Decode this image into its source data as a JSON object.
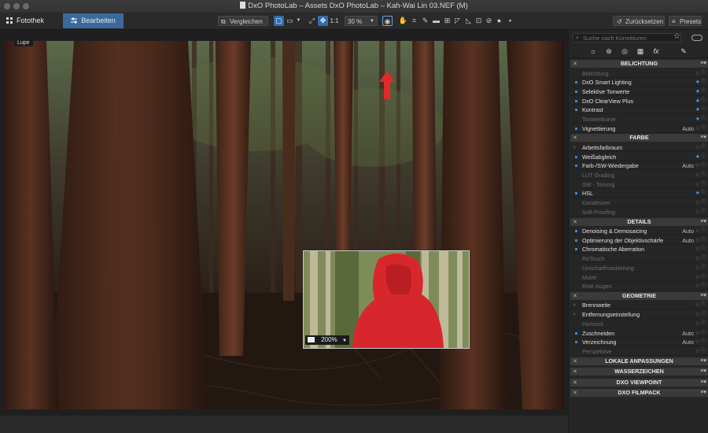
{
  "window": {
    "title": "DxO PhotoLab – Assets DxO PhotoLab – Kah-Wai Lin 03.NEF (M)"
  },
  "toolbar": {
    "tab_library": "Fotothek",
    "tab_edit": "Bearbeiten",
    "compare_label": "Vergleichen",
    "zoom_1to1": "1:1",
    "zoom_value": "30 %",
    "reset_label": "Zurücksetzen",
    "presets_label": "Presets"
  },
  "viewer": {
    "loupe_label": "Lupe",
    "loupe_zoom": "200%"
  },
  "colors": {
    "accent": "#2f6fb0",
    "arrow": "#e02a2a",
    "section_bg": "#3a3a3a",
    "favorite_star": "#4a94e6"
  },
  "panel": {
    "search_placeholder": "Suche nach Korrekturen",
    "sections": [
      {
        "title": "BELICHTUNG",
        "rows": [
          {
            "label": "Belichtung",
            "state": "off"
          },
          {
            "label": "DxO Smart Lighting",
            "state": "on",
            "fav": true
          },
          {
            "label": "Selektive Tonwerte",
            "state": "on",
            "fav": true
          },
          {
            "label": "DxO ClearView Plus",
            "state": "on",
            "fav": true
          },
          {
            "label": "Kontrast",
            "state": "on",
            "fav": true
          },
          {
            "label": "Tonwertkurve",
            "state": "off",
            "fav": true
          },
          {
            "label": "Vignettierung",
            "state": "on",
            "auto": "Auto"
          }
        ]
      },
      {
        "title": "FARBE",
        "rows": [
          {
            "label": "Arbeitsfarbraum",
            "state": "on",
            "chev": true
          },
          {
            "label": "Weißabgleich",
            "state": "on",
            "fav": true
          },
          {
            "label": "Farb-/SW-Wiedergabe",
            "state": "on",
            "auto": "Auto"
          },
          {
            "label": "LUT Grading",
            "state": "off"
          },
          {
            "label": "SW - Tonung",
            "state": "off"
          },
          {
            "label": "HSL",
            "state": "on",
            "fav": true
          },
          {
            "label": "Kanalmixer",
            "state": "off"
          },
          {
            "label": "Soft-Proofing",
            "state": "off"
          }
        ]
      },
      {
        "title": "DETAILS",
        "rows": [
          {
            "label": "Denoising & Demosaicing",
            "state": "on",
            "auto": "Auto"
          },
          {
            "label": "Optimierung der Objektivschärfe",
            "state": "on",
            "auto": "Auto"
          },
          {
            "label": "Chromatische Aberration",
            "state": "on"
          },
          {
            "label": "ReTouch",
            "state": "off"
          },
          {
            "label": "Unscharfmaskierung",
            "state": "off"
          },
          {
            "label": "Moiré",
            "state": "off"
          },
          {
            "label": "Rote Augen",
            "state": "off"
          }
        ]
      },
      {
        "title": "GEOMETRIE",
        "rows": [
          {
            "label": "Brennweite",
            "state": "on",
            "chev": true
          },
          {
            "label": "Entfernungseinstellung",
            "state": "on",
            "chev": true
          },
          {
            "label": "Horizont",
            "state": "off"
          },
          {
            "label": "Zuschneiden",
            "state": "on",
            "auto": "Auto"
          },
          {
            "label": "Verzeichnung",
            "state": "on",
            "auto": "Auto"
          },
          {
            "label": "Perspektive",
            "state": "off"
          }
        ]
      }
    ],
    "collapsed_sections": [
      "LOKALE ANPASSUNGEN",
      "WASSERZEICHEN",
      "DXO VIEWPOINT",
      "DXO FILMPACK"
    ]
  }
}
